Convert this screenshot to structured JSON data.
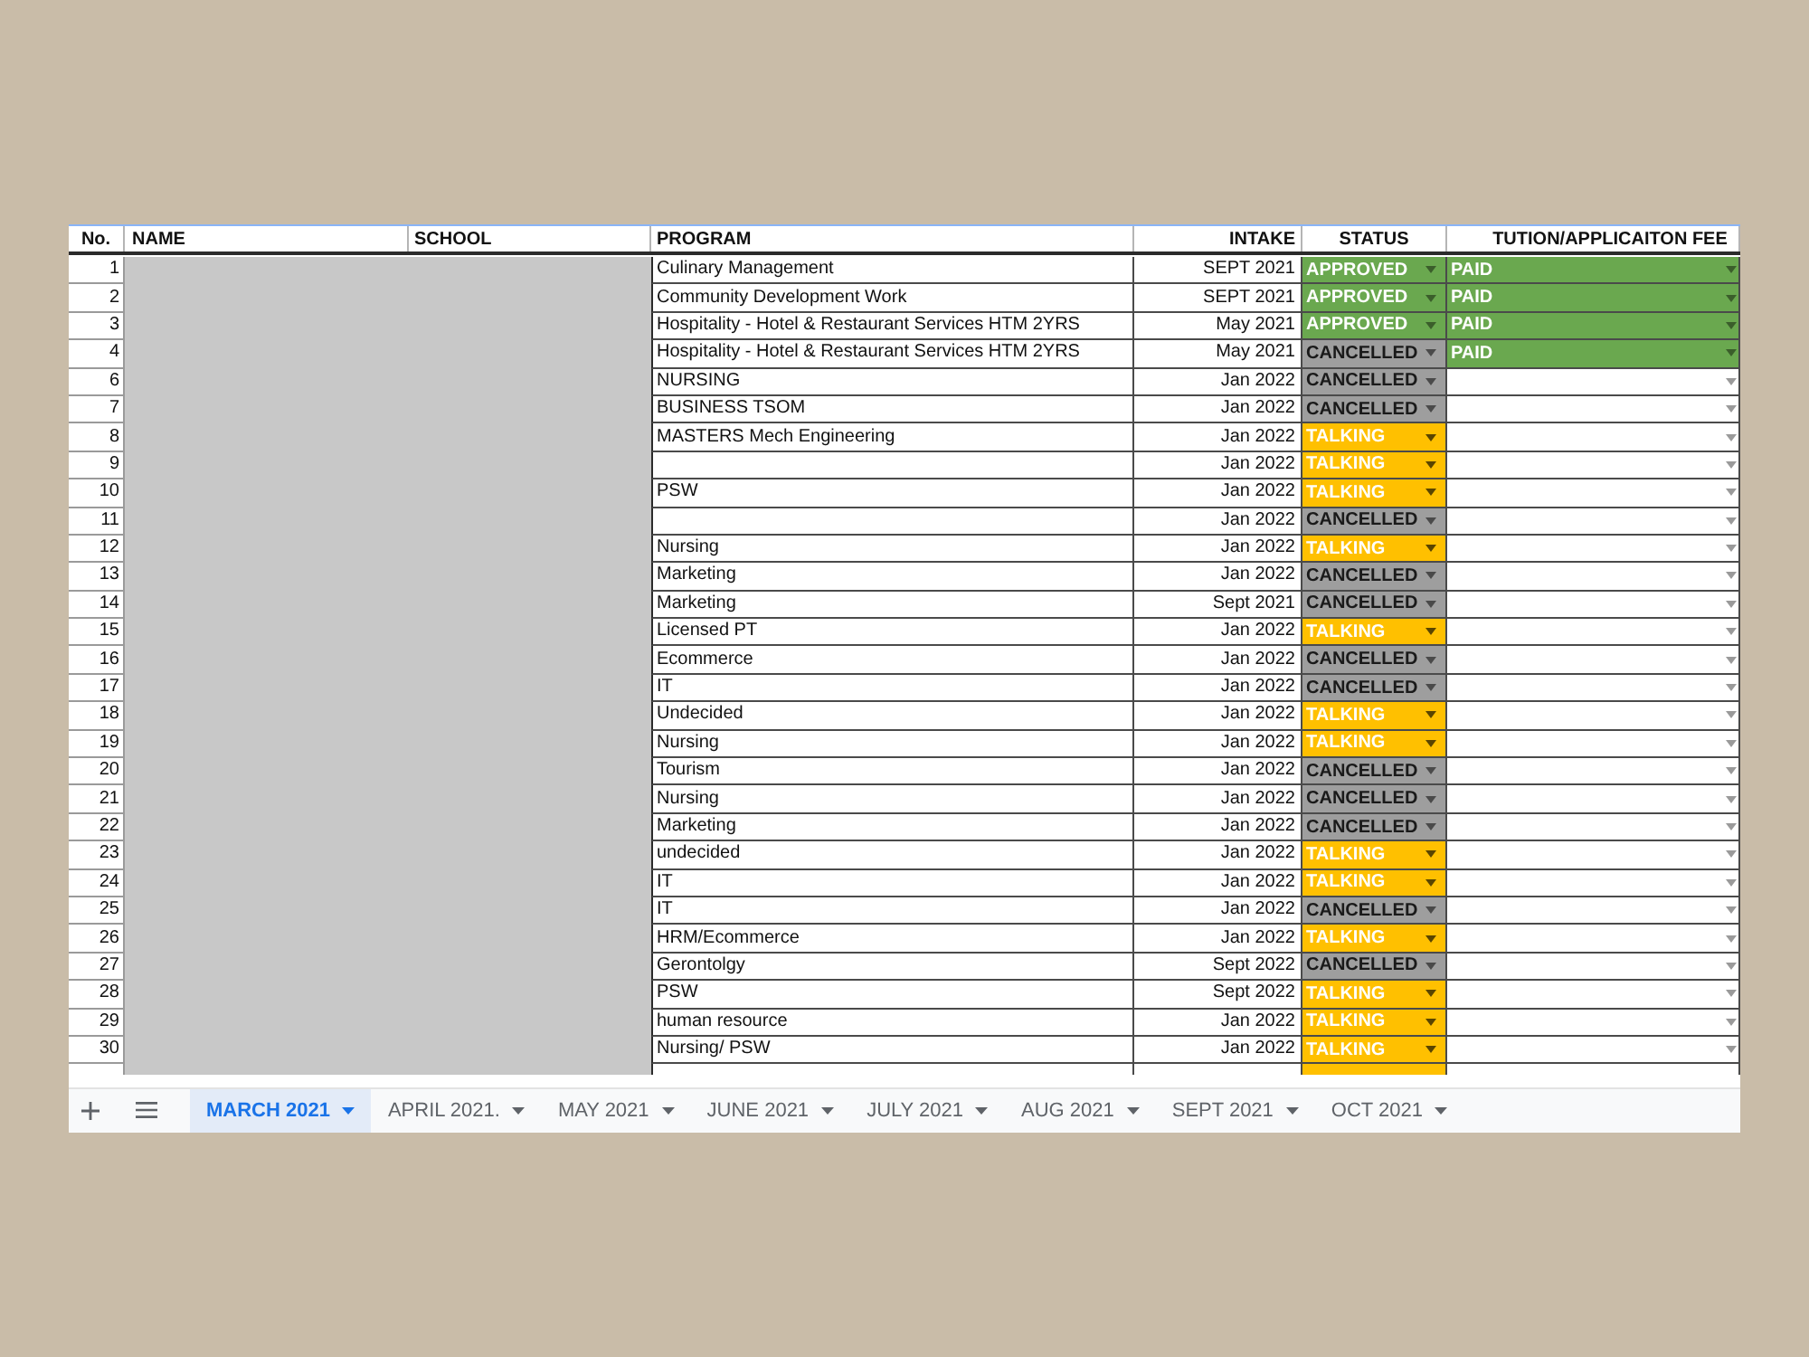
{
  "columns": [
    "No.",
    "NAME",
    "SCHOOL",
    "PROGRAM",
    "INTAKE",
    "STATUS",
    "TUTION/APPLICAITON FEE"
  ],
  "rows": [
    {
      "no": "1",
      "program": "Culinary Management",
      "intake": "SEPT 2021",
      "status": {
        "label": "APPROVED",
        "kind": "approved"
      },
      "fee": {
        "label": "PAID",
        "kind": "paid"
      }
    },
    {
      "no": "2",
      "program": "Community Development Work",
      "intake": "SEPT 2021",
      "status": {
        "label": "APPROVED",
        "kind": "approved"
      },
      "fee": {
        "label": "PAID",
        "kind": "paid"
      }
    },
    {
      "no": "3",
      "program": "Hospitality - Hotel & Restaurant Services HTM 2YRS",
      "intake": "May 2021",
      "status": {
        "label": "APPROVED",
        "kind": "approved"
      },
      "fee": {
        "label": "PAID",
        "kind": "paid"
      }
    },
    {
      "no": "4",
      "program": "Hospitality - Hotel & Restaurant Services HTM 2YRS",
      "intake": "May 2021",
      "status": {
        "label": "CANCELLED",
        "kind": "cancelled"
      },
      "fee": {
        "label": "PAID",
        "kind": "paid"
      }
    },
    {
      "no": "6",
      "program": "NURSING",
      "intake": "Jan 2022",
      "status": {
        "label": "CANCELLED",
        "kind": "cancelled"
      }
    },
    {
      "no": "7",
      "program": "BUSINESS TSOM",
      "intake": "Jan 2022",
      "status": {
        "label": "CANCELLED",
        "kind": "cancelled"
      }
    },
    {
      "no": "8",
      "program": "MASTERS Mech Engineering",
      "intake": "Jan 2022",
      "status": {
        "label": "TALKING",
        "kind": "talking"
      }
    },
    {
      "no": "9",
      "intake": "Jan 2022",
      "status": {
        "label": "TALKING",
        "kind": "talking"
      }
    },
    {
      "no": "10",
      "program": "PSW",
      "intake": "Jan 2022",
      "status": {
        "label": "TALKING",
        "kind": "talking"
      }
    },
    {
      "no": "11",
      "intake": "Jan 2022",
      "status": {
        "label": "CANCELLED",
        "kind": "cancelled"
      }
    },
    {
      "no": "12",
      "program": "Nursing",
      "intake": "Jan 2022",
      "status": {
        "label": "TALKING",
        "kind": "talking"
      }
    },
    {
      "no": "13",
      "program": "Marketing",
      "intake": "Jan 2022",
      "status": {
        "label": "CANCELLED",
        "kind": "cancelled"
      }
    },
    {
      "no": "14",
      "program": "Marketing",
      "intake": "Sept 2021",
      "status": {
        "label": "CANCELLED",
        "kind": "cancelled"
      }
    },
    {
      "no": "15",
      "program": "Licensed PT",
      "intake": "Jan 2022",
      "status": {
        "label": "TALKING",
        "kind": "talking"
      }
    },
    {
      "no": "16",
      "program": "Ecommerce",
      "intake": "Jan 2022",
      "status": {
        "label": "CANCELLED",
        "kind": "cancelled"
      }
    },
    {
      "no": "17",
      "program": "IT",
      "intake": "Jan 2022",
      "status": {
        "label": "CANCELLED",
        "kind": "cancelled"
      }
    },
    {
      "no": "18",
      "program": "Undecided",
      "intake": "Jan 2022",
      "status": {
        "label": "TALKING",
        "kind": "talking"
      }
    },
    {
      "no": "19",
      "program": "Nursing",
      "intake": "Jan 2022",
      "status": {
        "label": "TALKING",
        "kind": "talking"
      }
    },
    {
      "no": "20",
      "program": "Tourism",
      "intake": "Jan 2022",
      "status": {
        "label": "CANCELLED",
        "kind": "cancelled"
      }
    },
    {
      "no": "21",
      "program": "Nursing",
      "intake": "Jan 2022",
      "status": {
        "label": "CANCELLED",
        "kind": "cancelled"
      }
    },
    {
      "no": "22",
      "program": "Marketing",
      "intake": "Jan 2022",
      "status": {
        "label": "CANCELLED",
        "kind": "cancelled"
      }
    },
    {
      "no": "23",
      "program": "undecided",
      "intake": "Jan 2022",
      "status": {
        "label": "TALKING",
        "kind": "talking"
      }
    },
    {
      "no": "24",
      "program": "IT",
      "intake": "Jan 2022",
      "status": {
        "label": "TALKING",
        "kind": "talking"
      }
    },
    {
      "no": "25",
      "program": "IT",
      "intake": "Jan 2022",
      "status": {
        "label": "CANCELLED",
        "kind": "cancelled"
      }
    },
    {
      "no": "26",
      "program": "HRM/Ecommerce",
      "intake": "Jan 2022",
      "status": {
        "label": "TALKING",
        "kind": "talking"
      }
    },
    {
      "no": "27",
      "program": "Gerontolgy",
      "intake": "Sept 2022",
      "status": {
        "label": "CANCELLED",
        "kind": "cancelled"
      }
    },
    {
      "no": "28",
      "program": "PSW",
      "intake": "Sept 2022",
      "status": {
        "label": "TALKING",
        "kind": "talking"
      }
    },
    {
      "no": "29",
      "program": "human resource",
      "intake": "Jan 2022",
      "status": {
        "label": "TALKING",
        "kind": "talking"
      }
    },
    {
      "no": "30",
      "program": "Nursing/ PSW",
      "intake": "Jan 2022",
      "status": {
        "label": "TALKING",
        "kind": "talking"
      }
    }
  ],
  "cut_off_row": {
    "status": {
      "kind": "talking"
    }
  },
  "sheet_tabs": [
    {
      "label": "MARCH 2021",
      "selected": true
    },
    {
      "label": "APRIL 2021.",
      "selected": false
    },
    {
      "label": "MAY 2021",
      "selected": false
    },
    {
      "label": "JUNE 2021",
      "selected": false
    },
    {
      "label": "JULY 2021",
      "selected": false
    },
    {
      "label": "AUG 2021",
      "selected": false
    },
    {
      "label": "SEPT 2021",
      "selected": false
    },
    {
      "label": "OCT 2021",
      "selected": false
    }
  ]
}
